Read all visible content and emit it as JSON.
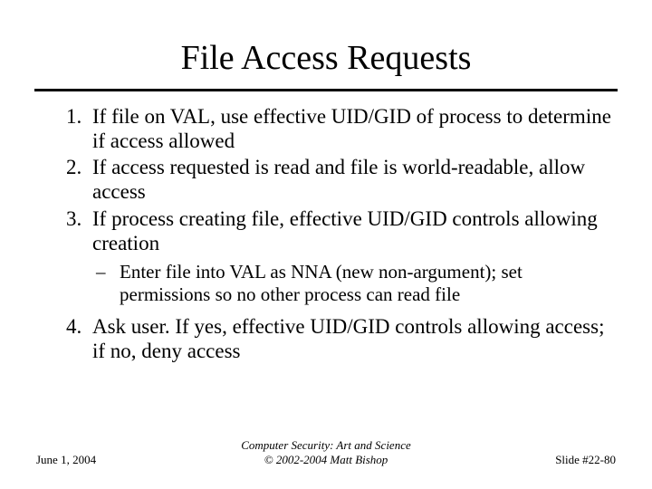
{
  "title": "File Access Requests",
  "items": {
    "i1": "If file on VAL, use effective UID/GID of process to determine if access allowed",
    "i2": "If access requested is read and file is world-readable, allow access",
    "i3": "If process creating file, effective UID/GID controls allowing creation",
    "i3sub": "Enter file into VAL as NNA (new non-argument); set permissions so no other process can read file",
    "i4": "Ask user. If yes, effective UID/GID controls allowing access; if no, deny access"
  },
  "footer": {
    "date": "June 1, 2004",
    "center_line1": "Computer Security: Art and Science",
    "center_line2": "© 2002-2004 Matt Bishop",
    "slide": "Slide #22-80"
  }
}
